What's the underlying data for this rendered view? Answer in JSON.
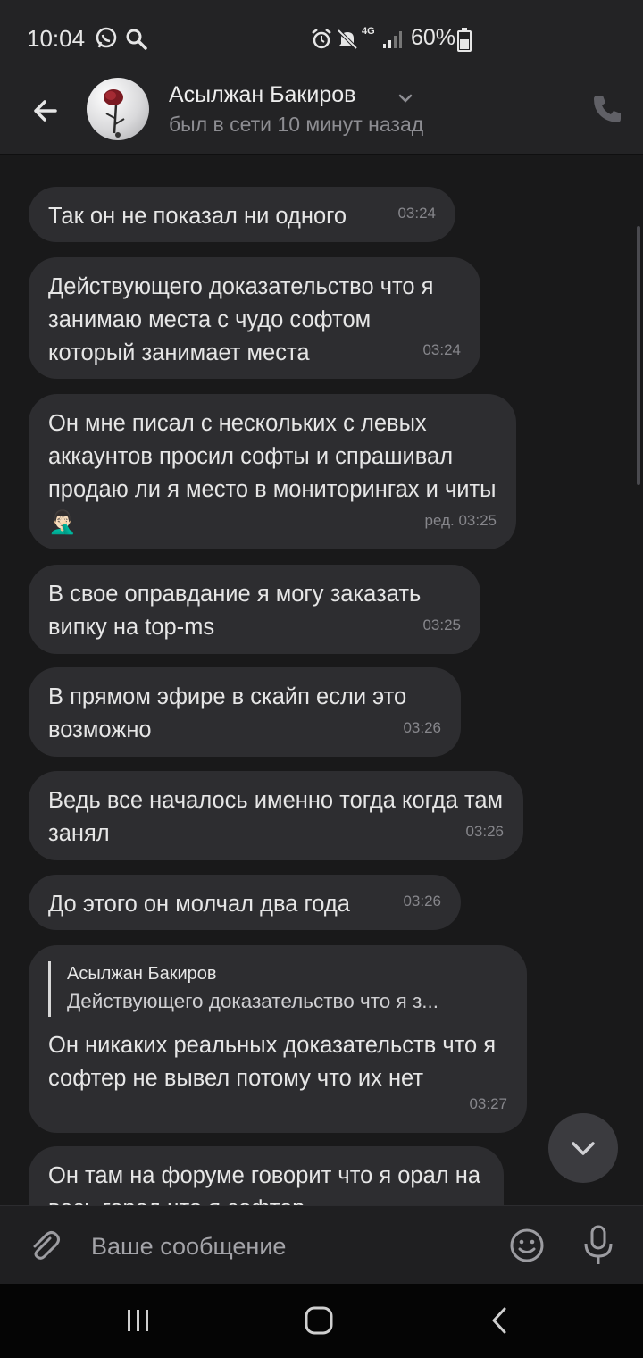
{
  "status_bar": {
    "time": "10:04",
    "network": "4G",
    "battery_text": "60%",
    "battery_level": 0.6
  },
  "header": {
    "contact_name": "Асылжан Бакиров",
    "contact_status": "был в сети 10 минут назад"
  },
  "messages": [
    {
      "text": "Так он не показал ни одного",
      "time": "03:24"
    },
    {
      "text": "Действующего доказательство что я занимаю места с чудо софтом который занимает места",
      "time": "03:24"
    },
    {
      "text": "Он мне писал с нескольких с левых аккаунтов просил софты и спрашивал продаю ли я место в мониторингах и читы 🤦🏻‍♂️",
      "time": "ред. 03:25"
    },
    {
      "text": "В свое оправдание я могу заказать випку на top-ms",
      "time": "03:25"
    },
    {
      "text": "В прямом эфире в скайп если это возможно",
      "time": "03:26"
    },
    {
      "text": "Ведь все началось именно тогда когда там занял",
      "time": "03:26"
    },
    {
      "text": "До этого он молчал два года",
      "time": "03:26"
    },
    {
      "quote_name": "Асылжан Бакиров",
      "quote_text": "Действующего доказательство что я з...",
      "text": "Он никаких реальных доказательств что я софтер не  вывел потому что их нет",
      "time": "03:27"
    },
    {
      "text": "Он там на форуме говорит что я орал на весь город что я софтер"
    }
  ],
  "composer": {
    "placeholder": "Ваше сообщение"
  },
  "icons": {
    "status": [
      "whatsapp-icon",
      "search-icon",
      "alarm-icon",
      "mute-icon",
      "signal-icon",
      "battery-icon"
    ],
    "header": [
      "back-arrow-icon",
      "chevron-down-icon",
      "phone-icon"
    ],
    "composer": [
      "paperclip-icon",
      "emoji-icon",
      "microphone-icon"
    ],
    "nav": [
      "recent-apps-icon",
      "home-icon",
      "nav-back-icon"
    ]
  },
  "colors": {
    "background": "#19191a",
    "bubble": "#2d2d30",
    "bar": "#232325"
  }
}
